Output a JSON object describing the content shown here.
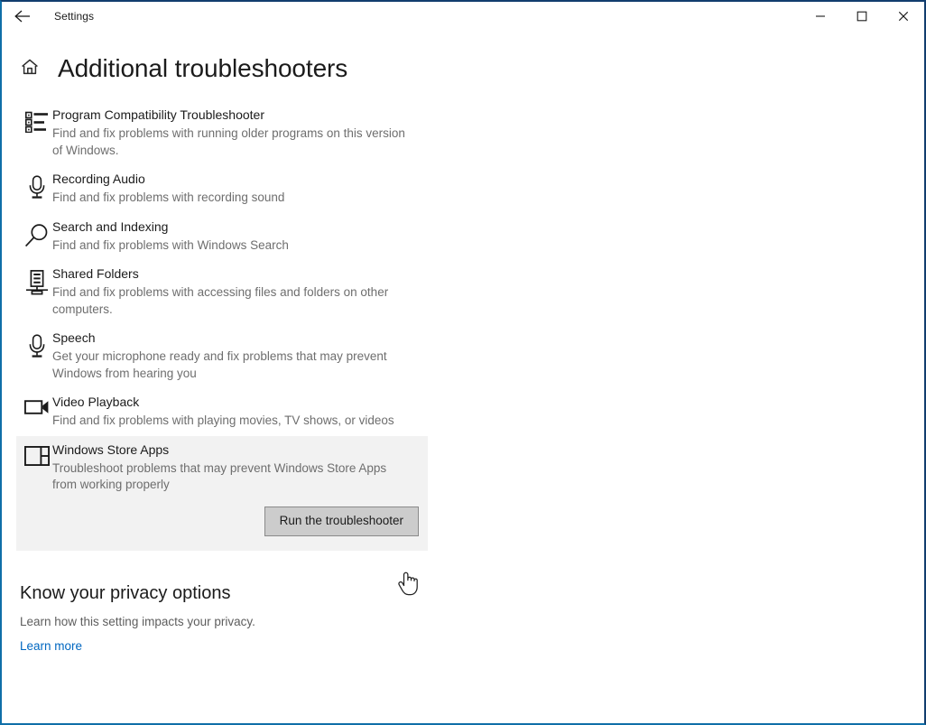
{
  "window": {
    "app_title": "Settings",
    "back_icon": "back-arrow-icon",
    "minimize_label": "—",
    "maximize_label": "□",
    "close_label": "✕",
    "border_accent_color": "#0f6fa8",
    "border_inactive_color": "#123d6e"
  },
  "header": {
    "home_icon": "home-icon",
    "title": "Additional troubleshooters"
  },
  "troubleshooters": [
    {
      "icon": "list-bullets-icon",
      "name": "Program Compatibility Troubleshooter",
      "description": "Find and fix problems with running older programs on this version of Windows.",
      "selected": false
    },
    {
      "icon": "microphone-icon",
      "name": "Recording Audio",
      "description": "Find and fix problems with recording sound",
      "selected": false
    },
    {
      "icon": "magnifier-icon",
      "name": "Search and Indexing",
      "description": "Find and fix problems with Windows Search",
      "selected": false
    },
    {
      "icon": "server-share-icon",
      "name": "Shared Folders",
      "description": "Find and fix problems with accessing files and folders on other computers.",
      "selected": false
    },
    {
      "icon": "microphone-icon",
      "name": "Speech",
      "description": "Get your microphone ready and fix problems that may prevent Windows from hearing you",
      "selected": false
    },
    {
      "icon": "video-camera-icon",
      "name": "Video Playback",
      "description": "Find and fix problems with playing movies, TV shows, or videos",
      "selected": false
    },
    {
      "icon": "app-window-icon",
      "name": "Windows Store Apps",
      "description": "Troubleshoot problems that may prevent Windows Store Apps from working properly",
      "selected": true
    }
  ],
  "action": {
    "run_button_label": "Run the troubleshooter",
    "button_bg": "#cccccc",
    "button_border": "#8a8a8a"
  },
  "privacy": {
    "title": "Know your privacy options",
    "description": "Learn how this setting impacts your privacy.",
    "link_label": "Learn more",
    "link_color": "#0067c0"
  },
  "cursor": {
    "type": "hand-pointer-cursor"
  }
}
